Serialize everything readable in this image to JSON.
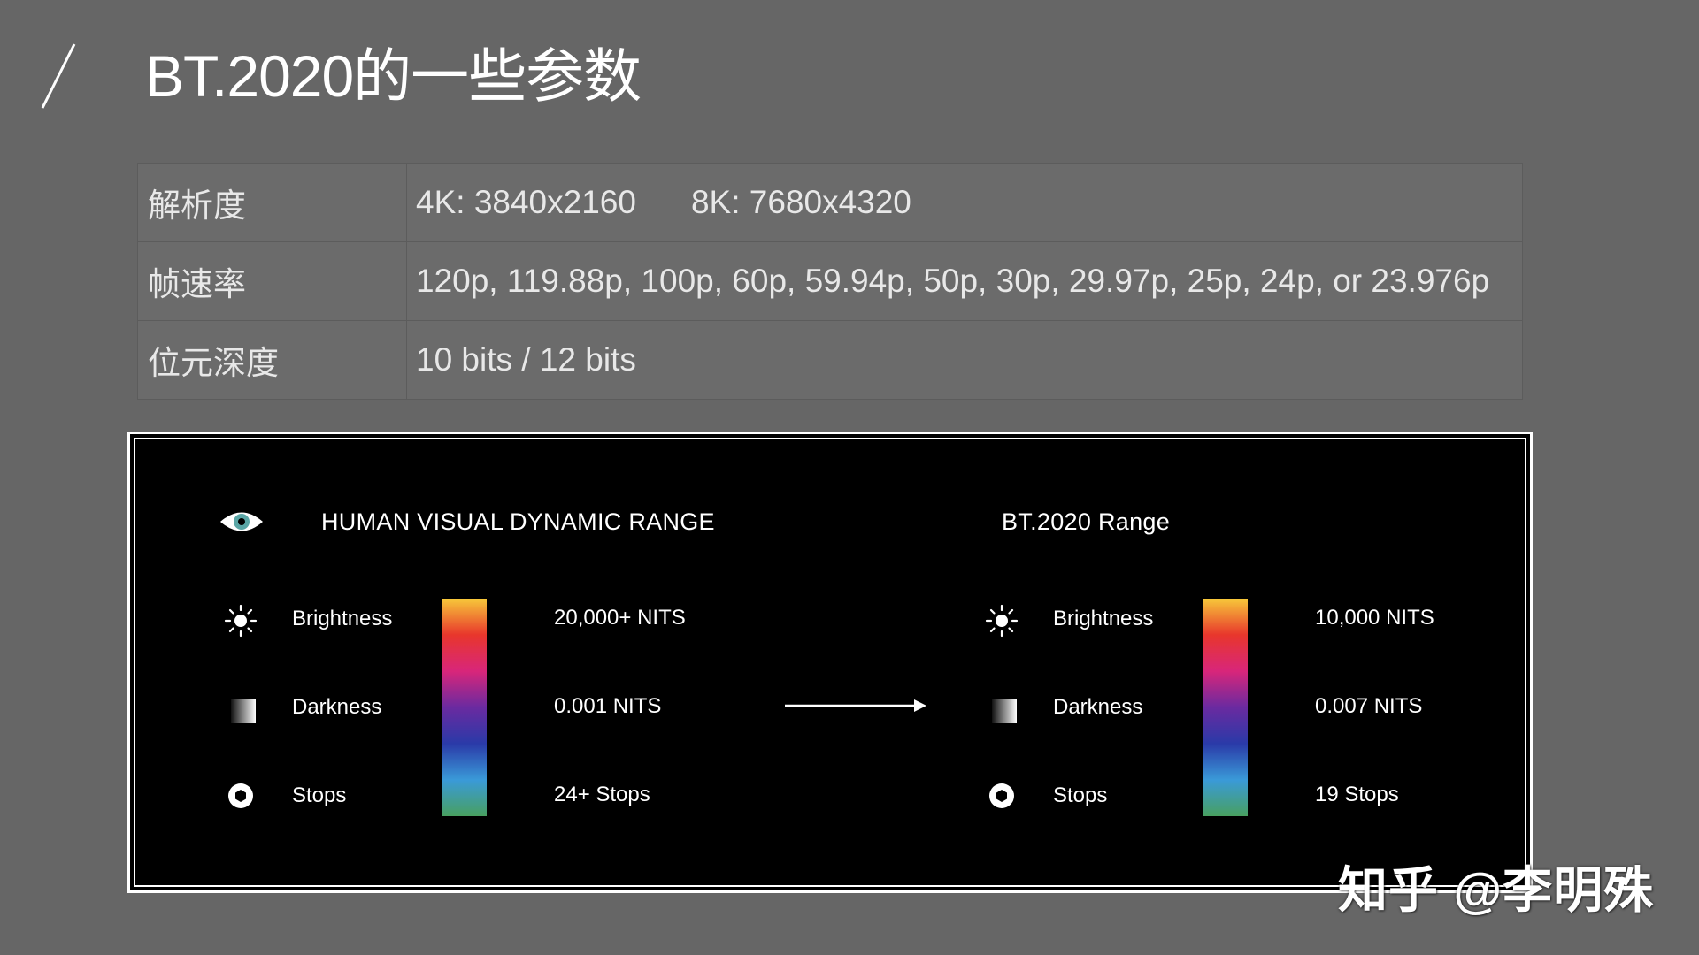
{
  "slide": {
    "title": "BT.2020的一些参数"
  },
  "spec_table": {
    "rows": [
      {
        "key": "解析度",
        "values": [
          "4K: 3840x2160",
          "8K: 7680x4320"
        ]
      },
      {
        "key": "帧速率",
        "values": [
          "120p, 119.88p, 100p, 60p, 59.94p, 50p, 30p, 29.97p, 25p, 24p, or 23.976p"
        ]
      },
      {
        "key": "位元深度",
        "values": [
          "10 bits / 12 bits"
        ]
      }
    ]
  },
  "panel": {
    "left": {
      "heading": "HUMAN  VISUAL DYNAMIC RANGE",
      "rows": [
        {
          "icon": "sun-icon",
          "label": "Brightness",
          "value": "20,000+ NITS"
        },
        {
          "icon": "gradient-square-icon",
          "label": "Darkness",
          "value": "0.001 NITS"
        },
        {
          "icon": "aperture-icon",
          "label": "Stops",
          "value": "24+ Stops"
        }
      ]
    },
    "right": {
      "heading": "BT.2020 Range",
      "rows": [
        {
          "icon": "sun-icon",
          "label": "Brightness",
          "value": "10,000 NITS"
        },
        {
          "icon": "gradient-square-icon",
          "label": "Darkness",
          "value": "0.007 NITS"
        },
        {
          "icon": "aperture-icon",
          "label": "Stops",
          "value": "19 Stops"
        }
      ]
    },
    "header_icon": "eye-icon",
    "arrow_icon": "arrow-right-icon",
    "gradient_colors": [
      "#f7c83a",
      "#e8362c",
      "#d8267a",
      "#6a2aa0",
      "#2a3aa8",
      "#3a9ad8",
      "#48a060"
    ]
  },
  "watermark": "知乎 @李明殊",
  "colors": {
    "background": "#666666",
    "table_background": "#6b6b6b",
    "panel_background": "#000000",
    "text": "#ffffff"
  }
}
